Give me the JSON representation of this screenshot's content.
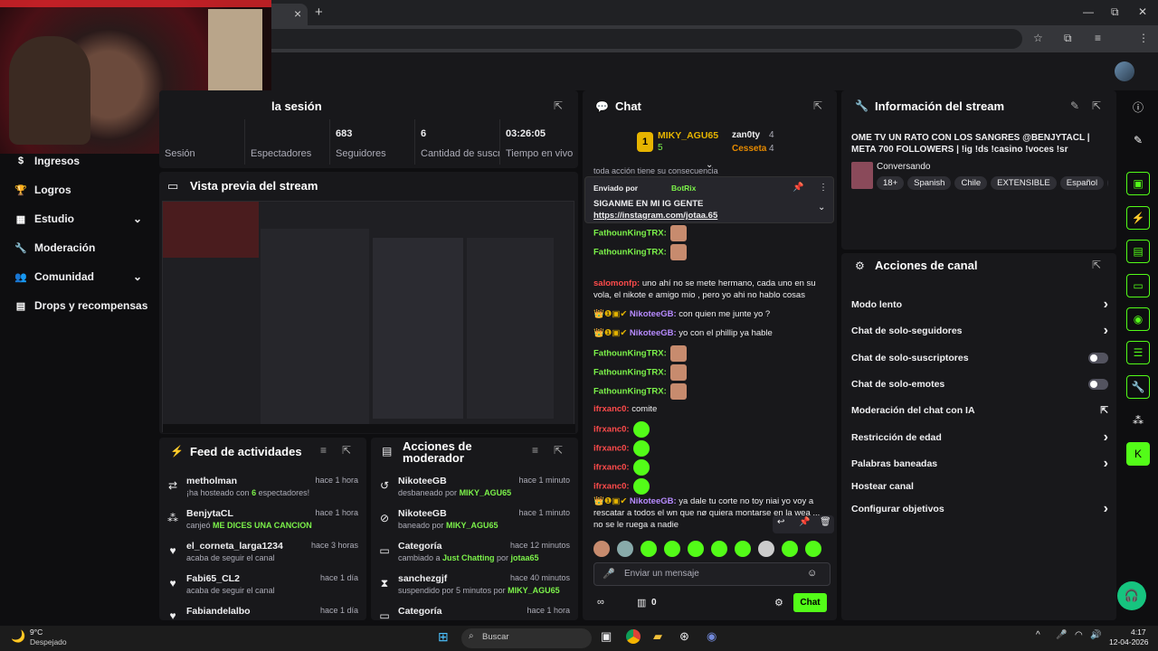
{
  "browser": {
    "window_controls": [
      "—",
      "⧉",
      "✕"
    ],
    "new_tab": "+",
    "tab_close": "×"
  },
  "sidebar": {
    "items": [
      {
        "label": "Ingresos",
        "icon": "money-icon"
      },
      {
        "label": "Logros",
        "icon": "trophy-icon"
      },
      {
        "label": "Estudio",
        "icon": "studio-icon"
      },
      {
        "label": "Moderación",
        "icon": "wrench-icon"
      },
      {
        "label": "Comunidad",
        "icon": "community-icon"
      },
      {
        "label": "Drops y recompensas",
        "icon": "gift-icon"
      }
    ]
  },
  "session": {
    "title_tail": "la sesión",
    "stats": [
      {
        "value": "",
        "label": "Sesión"
      },
      {
        "value": "",
        "label": "Espectadores"
      },
      {
        "value": "683",
        "label": "Seguidores"
      },
      {
        "value": "6",
        "label": "Cantidad de suscripciones"
      },
      {
        "value": "03:26:05",
        "label": "Tiempo en vivo"
      }
    ]
  },
  "preview": {
    "title": "Vista previa del stream"
  },
  "feed": {
    "title": "Feed de actividades",
    "items": [
      {
        "name": "metholman",
        "time": "hace 1 hora",
        "pre": "¡ha hosteado con ",
        "hl": "6",
        "post": " espectadores!",
        "icon": "host-icon"
      },
      {
        "name": "BenjytaCL",
        "time": "hace 1 hora",
        "pre": "canjeó ",
        "hl": "ME DICES UNA CANCION",
        "post": "",
        "icon": "redeem-icon"
      },
      {
        "name": "el_corneta_larga1234",
        "time": "hace 3 horas",
        "pre": "acaba de seguir el canal",
        "hl": "",
        "post": "",
        "icon": "heart-icon"
      },
      {
        "name": "Fabi65_CL2",
        "time": "hace 1 día",
        "pre": "acaba de seguir el canal",
        "hl": "",
        "post": "",
        "icon": "heart-icon"
      },
      {
        "name": "Fabiandelalbo",
        "time": "hace 1 día",
        "pre": "",
        "hl": "",
        "post": "",
        "icon": "heart-icon"
      }
    ]
  },
  "modactions": {
    "title_l1": "Acciones de",
    "title_l2": "moderador",
    "items": [
      {
        "name": "NikoteeGB",
        "time": "hace 1 minuto",
        "pre": "desbaneado por ",
        "hl": "MIKY_AGU65",
        "mid": "",
        "hl2": "",
        "icon": "undo-icon"
      },
      {
        "name": "NikoteeGB",
        "time": "hace 1 minuto",
        "pre": "baneado por ",
        "hl": "MIKY_AGU65",
        "mid": "",
        "hl2": "",
        "icon": "ban-icon"
      },
      {
        "name": "Categoría",
        "time": "hace 12 minutos",
        "pre": "cambiado a ",
        "hl": "Just Chatting",
        "mid": " por ",
        "hl2": "jotaa65",
        "icon": "category-icon"
      },
      {
        "name": "sanchezgjf",
        "time": "hace 40 minutos",
        "pre": "suspendido por 5 minutos por ",
        "hl": "MIKY_AGU65",
        "mid": "",
        "hl2": "",
        "icon": "hourglass-icon"
      },
      {
        "name": "Categoría",
        "time": "hace 1 hora",
        "pre": "",
        "hl": "",
        "mid": "",
        "hl2": "",
        "icon": "category-icon"
      }
    ]
  },
  "chat": {
    "title": "Chat",
    "leader1": {
      "name": "MIKY_AGU65",
      "count": "5"
    },
    "leader2": {
      "name": "zan0ty",
      "count": "4"
    },
    "leader3": {
      "name": "Cesseta",
      "count": "4"
    },
    "cut_text": "toda acción tiene su consecuencia",
    "pinned": {
      "by_label": "Enviado por",
      "by_user": "BotRix",
      "line1": "SIGANME EN MI IG GENTE",
      "line2": "https://instagram.com/jotaa.65"
    },
    "messages": [
      {
        "u": "FathounKingTRX:",
        "c": "g",
        "t": "",
        "e": 1
      },
      {
        "u": "FathounKingTRX:",
        "c": "g",
        "t": "",
        "e": 1
      },
      {
        "u": "salomonfp:",
        "c": "r",
        "t": " uno ahí no se mete hermano, cada uno en su vola, el nikote e amigo mio , pero yo ahi no hablo cosas",
        "e": 0
      },
      {
        "u": "NikoteeGB:",
        "c": "p",
        "t": " con quien me junte yo ?",
        "e": 0
      },
      {
        "u": "NikoteeGB:",
        "c": "p",
        "t": " yo con el phillip ya hable",
        "e": 0
      },
      {
        "u": "FathounKingTRX:",
        "c": "g",
        "t": "",
        "e": 1
      },
      {
        "u": "FathounKingTRX:",
        "c": "g",
        "t": "",
        "e": 1
      },
      {
        "u": "FathounKingTRX:",
        "c": "g",
        "t": "",
        "e": 1
      },
      {
        "u": "ifrxanc0:",
        "c": "r",
        "t": " comite",
        "e": 0
      },
      {
        "u": "ifrxanc0:",
        "c": "r",
        "t": "",
        "e": 2
      },
      {
        "u": "ifrxanc0:",
        "c": "r",
        "t": "",
        "e": 2
      },
      {
        "u": "ifrxanc0:",
        "c": "r",
        "t": "",
        "e": 2
      },
      {
        "u": "ifrxanc0:",
        "c": "r",
        "t": "",
        "e": 2
      },
      {
        "u": "NikoteeGB:",
        "c": "p",
        "t": " ya dale tu corte no toy niai yo voy a rescatar a todos el wn que nø quiera montarse en la wea ... no se le ruega a nadie",
        "e": 0
      }
    ],
    "input_placeholder": "Enviar un mensaje",
    "points": "0",
    "send": "Chat"
  },
  "info": {
    "title": "Información del stream",
    "stream_title": "OME TV UN RATO CON LOS SANGRES @BENJYTACL | META 700 FOLLOWERS | !ig !ds !casino !voces !sr",
    "category": "Conversando",
    "tags": [
      "18+",
      "Spanish",
      "Chile",
      "EXTENSIBLE",
      "Español",
      "c"
    ]
  },
  "channel": {
    "title": "Acciones de canal",
    "items": [
      {
        "label": "Modo lento",
        "ctrl": "chevron"
      },
      {
        "label": "Chat de solo-seguidores",
        "ctrl": "chevron"
      },
      {
        "label": "Chat de solo-suscriptores",
        "ctrl": "toggle"
      },
      {
        "label": "Chat de solo-emotes",
        "ctrl": "toggle"
      },
      {
        "label": "Moderación del chat con IA",
        "ctrl": "link"
      },
      {
        "label": "Restricción de edad",
        "ctrl": "chevron"
      },
      {
        "label": "Palabras baneadas",
        "ctrl": "chevron"
      },
      {
        "label": "Hostear canal",
        "ctrl": "none"
      },
      {
        "label": "Configurar objetivos",
        "ctrl": "chevron"
      }
    ]
  },
  "taskbar": {
    "weather_temp": "9°C",
    "weather_desc": "Despejado",
    "search": "Buscar",
    "time": "4:17",
    "date": "12-04-2026"
  },
  "colors": {
    "accent": "#53fc18",
    "panel": "#18181b",
    "bg": "#0e0e10"
  }
}
